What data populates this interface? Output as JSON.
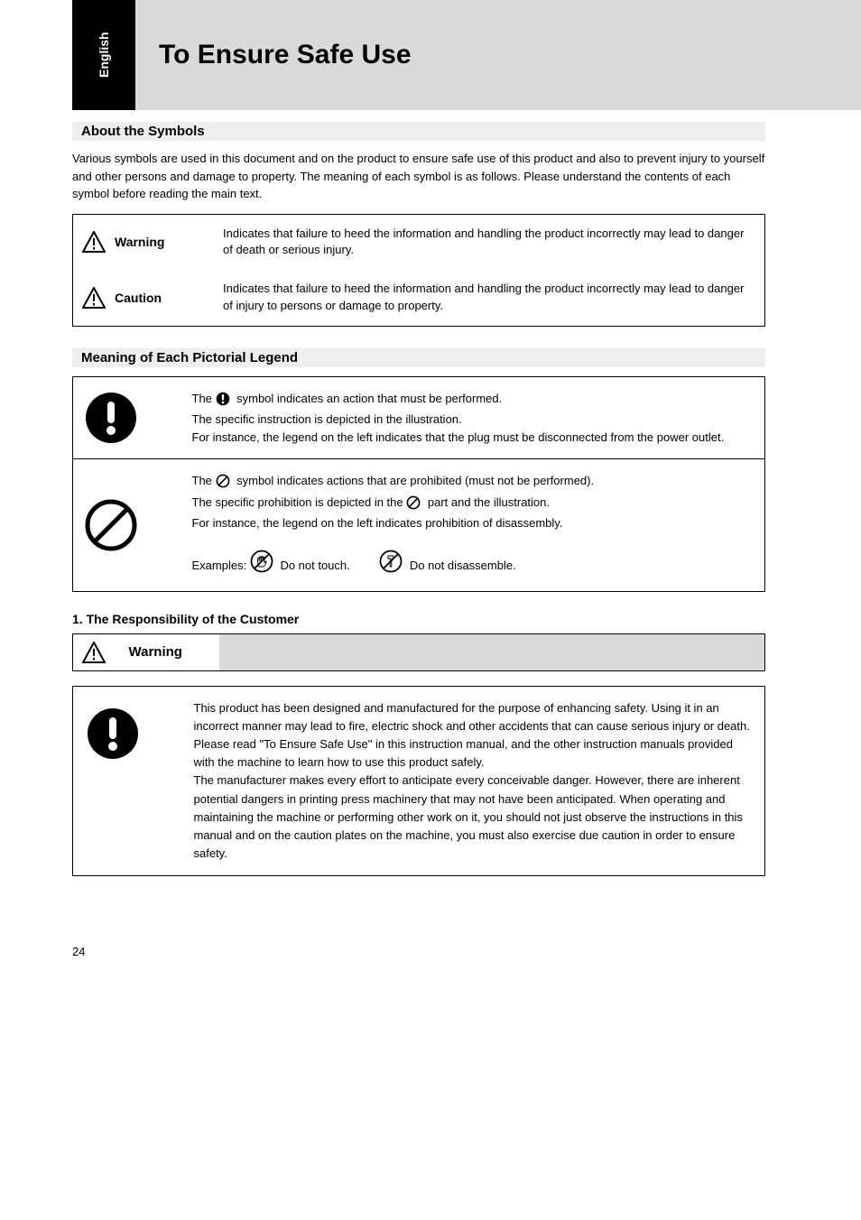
{
  "side_tab": "English",
  "page_title": "To Ensure Safe Use",
  "section_title": "About the Symbols",
  "intro_paragraph": "Various symbols are used in this document and on the product to ensure safe use of this product and also to prevent injury to yourself and other persons and damage to property. The meaning of each symbol is as follows. Please understand the contents of each symbol before reading the main text.",
  "definitions": {
    "warning": {
      "label": "Warning",
      "text": "Indicates that failure to heed the information and handling the product incorrectly may lead to danger of death or serious injury."
    },
    "caution": {
      "label": "Caution",
      "text": "Indicates that failure to heed the information and handling the product incorrectly may lead to danger of injury to persons or damage to property."
    }
  },
  "legends_title": "Meaning of Each Pictorial Legend",
  "legends": {
    "instruction": {
      "line1_prefix": "The ",
      "line1_suffix": " symbol indicates an action that must be performed.",
      "line2": "The specific instruction is depicted in the illustration.",
      "line3": "For instance, the legend on the left indicates that the plug must be disconnected from the power outlet."
    },
    "prohibition": {
      "line1_prefix": "The ",
      "line1_suffix": " symbol indicates actions that are prohibited (must not be performed).",
      "line2_prefix": "The specific prohibition is depicted in the ",
      "line2_suffix": " part and the illustration.",
      "line3": "For instance, the legend on the left indicates prohibition of disassembly.",
      "examples_prefix": "Examples: ",
      "example1": " Do not touch. ",
      "example2": " Do not disassemble."
    }
  },
  "subsection": "1. The Responsibility of the Customer",
  "warning_label": "Warning",
  "responsibility": {
    "para1": "This product has been designed and manufactured for the purpose of enhancing safety. Using it in an incorrect manner may lead to fire, electric shock and other accidents that can cause serious injury or death.",
    "para2": "Please read \"To Ensure Safe Use\" in this instruction manual, and the other instruction manuals provided with the machine to learn how to use this product safely.",
    "para3": "The manufacturer makes every effort to anticipate every conceivable danger. However, there are inherent potential dangers in printing press machinery that may not have been anticipated. When operating and maintaining the machine or performing other work on it, you should not just observe the instructions in this manual and on the caution plates on the machine, you must also exercise due caution in order to ensure safety."
  },
  "page_number": "24"
}
